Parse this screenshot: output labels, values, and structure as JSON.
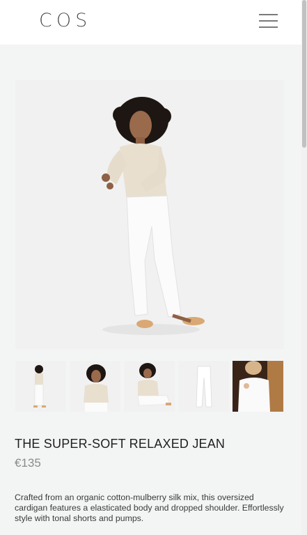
{
  "header": {
    "logo": "COS",
    "menu_icon": "hamburger-menu-icon"
  },
  "gallery": {
    "main_image": "model-full-body-photo",
    "thumbnails": [
      "model-full-body-thumb",
      "model-upper-body-thumb",
      "model-seated-thumb",
      "jean-flat-lay-thumb",
      "model-lifestyle-thumb"
    ]
  },
  "product": {
    "title": "THE SUPER-SOFT RELAXED JEAN",
    "price": "€135",
    "description": "Crafted from an organic cotton-mulberry silk mix, this oversized cardigan features a elasticated body and dropped shoulder. Effortlessly style with tonal shorts and pumps."
  },
  "colors": {
    "background": "#f3f4f4",
    "header": "#ffffff",
    "price": "#8a8a8a"
  }
}
